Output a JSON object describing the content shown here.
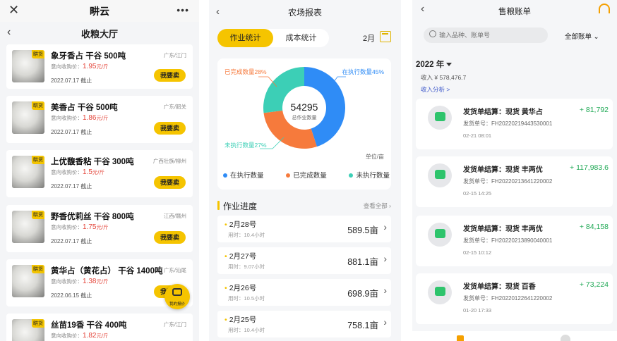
{
  "panel1": {
    "app_title": "畊云",
    "page_title": "收粮大厅",
    "price_prefix": "意向收购价：",
    "price_unit": "元/斤",
    "date_suffix": "截止",
    "sell_label": "我要卖",
    "badge": "畊货",
    "float_label": "我的报价",
    "items": [
      {
        "name": "象牙香占 干谷 500吨",
        "loc": "广东/江门",
        "price": "1.95",
        "date": "2022.07.17"
      },
      {
        "name": "美香占 干谷 500吨",
        "loc": "广东/韶关",
        "price": "1.86",
        "date": "2022.07.17"
      },
      {
        "name": "上优馥香粘 干谷 300吨",
        "loc": "广西壮族/柳州",
        "price": "1.5",
        "date": "2022.07.17"
      },
      {
        "name": "野香优莉丝 干谷 800吨",
        "loc": "江西/赣州",
        "price": "1.75",
        "date": "2022.07.17"
      },
      {
        "name": "黄华占（黄花占） 干谷 1400吨",
        "loc": "广东/汕尾",
        "price": "1.38",
        "date": "2022.06.15"
      },
      {
        "name": "丝苗19香 干谷 400吨",
        "loc": "广东/江门",
        "price": "1.82",
        "date": ""
      }
    ]
  },
  "panel2": {
    "title": "农场报表",
    "tab_active": "作业统计",
    "tab_inactive": "成本统计",
    "month": "2月",
    "center_value": "54295",
    "center_label": "总作业数量",
    "unit": "单位/亩",
    "label_executing": "在执行数量45%",
    "label_done": "已完成数量28%",
    "label_pending": "未执行数量27%",
    "section_title": "作业进度",
    "view_all": "查看全部 ›",
    "used_prefix": "用时：",
    "value_unit": "亩",
    "chart_data": {
      "type": "pie",
      "categories": [
        "在执行数量",
        "已完成数量",
        "未执行数量"
      ],
      "values": [
        45,
        28,
        27
      ],
      "colors": [
        "#2f8cf6",
        "#f67a3c",
        "#3ccfb6"
      ],
      "total": 54295
    },
    "legend": [
      {
        "label": "在执行数量",
        "color": "#2f8cf6"
      },
      {
        "label": "已完成数量",
        "color": "#f67a3c"
      },
      {
        "label": "未执行数量",
        "color": "#3ccfb6"
      }
    ],
    "progress": [
      {
        "date": "2月28号",
        "used": "10.4小时",
        "value": "589.5"
      },
      {
        "date": "2月27号",
        "used": "9.07小时",
        "value": "881.1"
      },
      {
        "date": "2月26号",
        "used": "10.5小时",
        "value": "698.9"
      },
      {
        "date": "2月25号",
        "used": "10.4小时",
        "value": "758.1"
      }
    ]
  },
  "panel3": {
    "title": "售粮账单",
    "search_placeholder": "输入品种、账单号",
    "filter": "全部账单",
    "year": "2022 年",
    "income": "收入 ¥ 578,476.7",
    "analysis": "收入分析 >",
    "order_prefix": "发货单号：",
    "bills": [
      {
        "title": "发货单结算：现货 黄华占",
        "order": "FH20220219443530001",
        "time": "02-21 08:01",
        "amount": "+ 81,792"
      },
      {
        "title": "发货单结算：现货 丰两优",
        "order": "FH20220213641220002",
        "time": "02-15 14:25",
        "amount": "+ 117,983.6"
      },
      {
        "title": "发货单结算：现货 丰两优",
        "order": "FH20220213890040001",
        "time": "02-15 10:12",
        "amount": "+ 84,158"
      },
      {
        "title": "发货单结算：现货 百香",
        "order": "FH20220122641220002",
        "time": "01-20 17:33",
        "amount": "+ 73,224"
      }
    ]
  }
}
